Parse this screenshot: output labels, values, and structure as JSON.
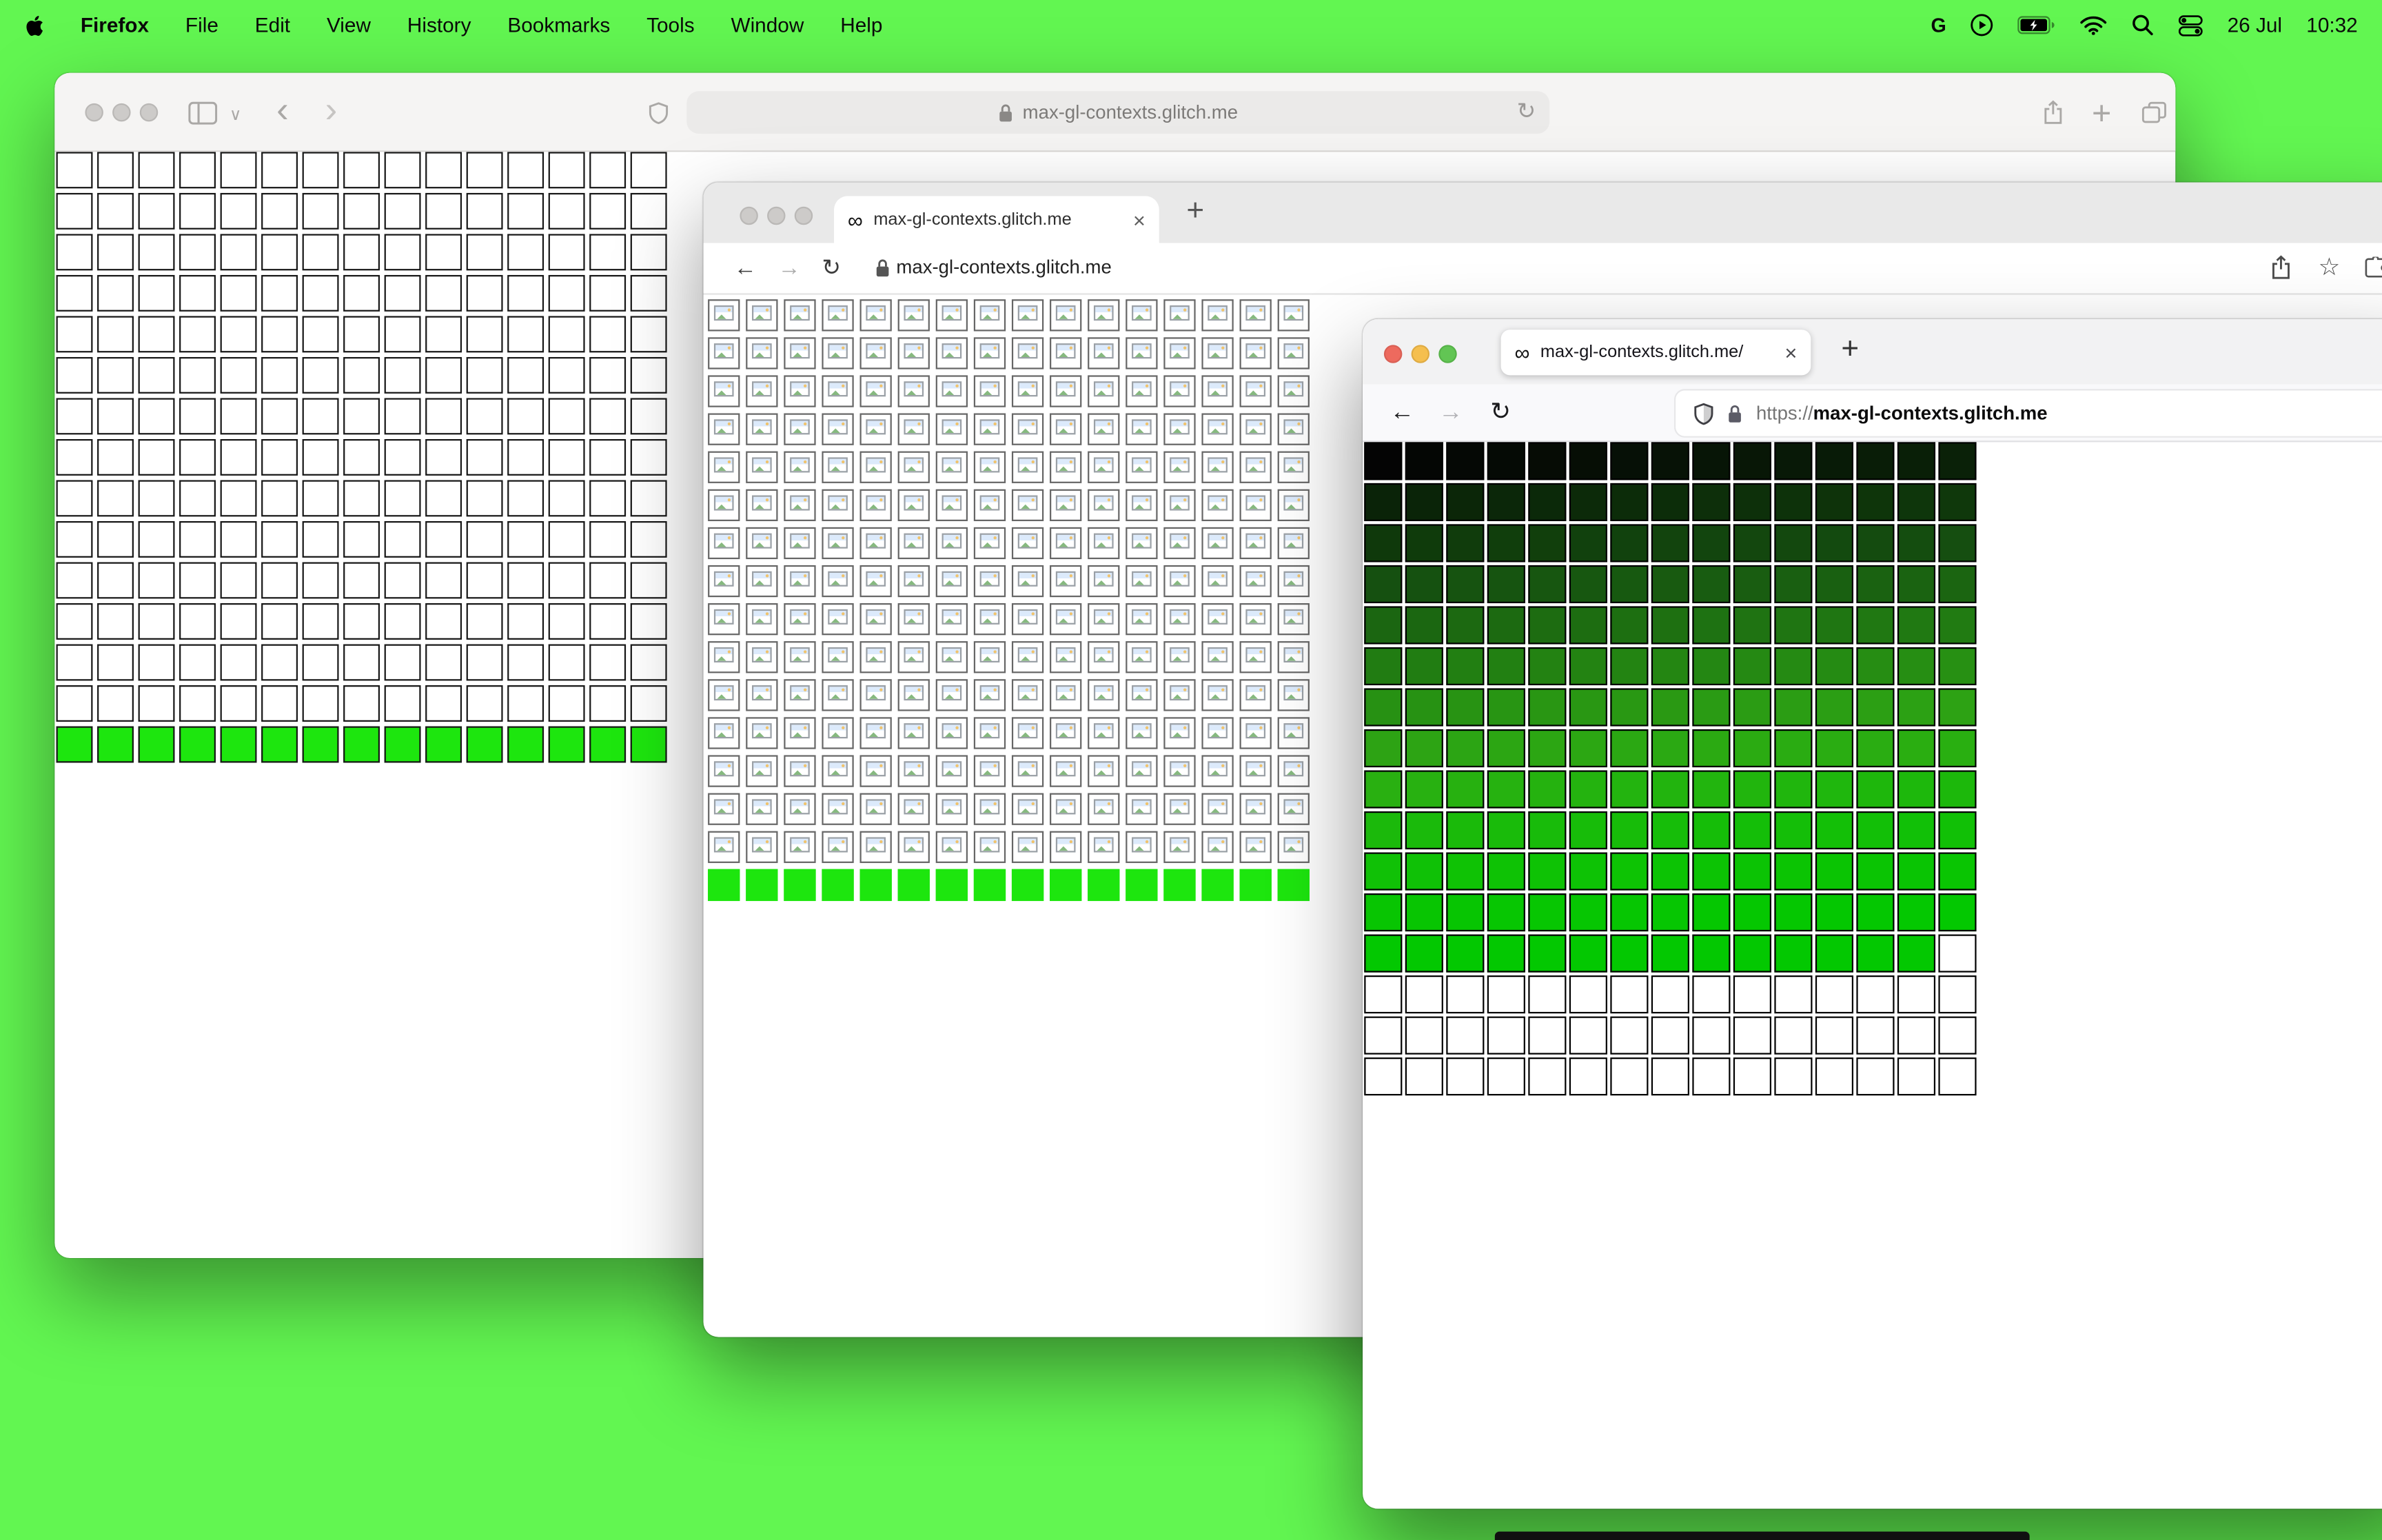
{
  "colors": {
    "desktop_green": "#62f651",
    "cell_green": "#1de60e"
  },
  "menu_bar": {
    "app_name": "Firefox",
    "menus": [
      "File",
      "Edit",
      "View",
      "History",
      "Bookmarks",
      "Tools",
      "Window",
      "Help"
    ],
    "status": {
      "g": "G",
      "date": "26 Jul",
      "time": "10:32"
    }
  },
  "icons": {
    "back_chevron": "‹",
    "forward_chevron": "›",
    "chevron_down": "∨",
    "back_arrow": "←",
    "forward_arrow": "→",
    "reload": "↻",
    "close": "×",
    "new_tab": "+",
    "star": "☆",
    "infinity": "∞"
  },
  "win_back": {
    "url": "max-gl-contexts.glitch.me",
    "grid": {
      "cols": 15,
      "rows": [
        {
          "count": 14,
          "fill": "#ffffff"
        },
        {
          "count": 1,
          "fill": "#1de60e"
        }
      ]
    }
  },
  "win_mid": {
    "tab_title": "max-gl-contexts.glitch.me",
    "url": "max-gl-contexts.glitch.me",
    "grid": {
      "cols": 16,
      "rows": [
        {
          "count": 15,
          "fill": "broken"
        },
        {
          "count": 1,
          "fill": "#1de60e",
          "borderless": true
        }
      ]
    }
  },
  "win_front": {
    "tab_title": "max-gl-contexts.glitch.me/",
    "url_scheme": "https://",
    "url_host": "max-gl-contexts.glitch.me",
    "grid": {
      "cols": 15,
      "row_colors": [
        "#040404",
        "#0a2308",
        "#0f390b",
        "#155010",
        "#1b6611",
        "#217c12",
        "#279113",
        "#2da314",
        "#29b011",
        "#1bb90b",
        "#10c106",
        "#08c502",
        "#03c801"
      ],
      "partial_last": 14,
      "white_rows": 3
    }
  }
}
